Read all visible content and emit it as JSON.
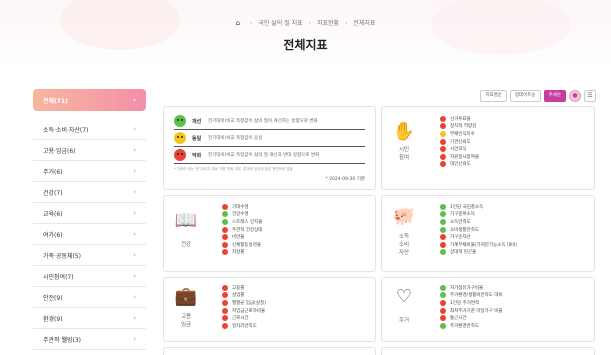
{
  "breadcrumb": {
    "home_icon": "home-icon",
    "items": [
      "국민 삶의 질 지표",
      "지표현황",
      "전체지표"
    ]
  },
  "page_title": "전체지표",
  "sidebar": {
    "items": [
      {
        "label": "전체(71)",
        "active": true
      },
      {
        "label": "소득·소비·자산(7)"
      },
      {
        "label": "고용·임금(6)"
      },
      {
        "label": "주거(6)"
      },
      {
        "label": "건강(7)"
      },
      {
        "label": "교육(6)"
      },
      {
        "label": "여가(6)"
      },
      {
        "label": "가족·공동체(5)"
      },
      {
        "label": "시민참여(7)"
      },
      {
        "label": "안전(9)"
      },
      {
        "label": "환경(9)"
      },
      {
        "label": "주관적 웰빙(3)"
      }
    ]
  },
  "toolbar": {
    "btn1": "지표명순",
    "btn2": "업데이트순",
    "btn3": "추세순",
    "icon1": "circle-icon",
    "icon2": "list-icon"
  },
  "legend": {
    "rows": [
      {
        "name": "개선",
        "desc": "전기대비(비교 측정값이 삶의 질이 개선하는 방향으로 변화",
        "color": "#5cc04b"
      },
      {
        "name": "동일",
        "desc": "전기대비(비교 측정값이 동일",
        "color": "#f3c51d"
      },
      {
        "name": "악화",
        "desc": "전기대비(비교 측정값이 삶의 질 개선과 반대 방향으로 변화",
        "color": "#ea4335"
      }
    ],
    "footnote": "* 기준이 되는 전기(비교) 대비 지표 변화 여부, 통계적 유의성 등은 판단하지 않음",
    "date": "* 2024-09-30 기준"
  },
  "categories": [
    {
      "id": "civic",
      "label": [
        "시민",
        "참여"
      ],
      "icon": "hand-vote-icon",
      "indicators": [
        {
          "label": "선거투표율",
          "status": "r"
        },
        {
          "label": "정치적 역량감",
          "status": "r"
        },
        {
          "label": "부패인식지수",
          "status": "y"
        },
        {
          "label": "기관신뢰도",
          "status": "r"
        },
        {
          "label": "시민의식",
          "status": "r"
        },
        {
          "label": "자원봉사참여율",
          "status": "r"
        },
        {
          "label": "대인신뢰도",
          "status": "r"
        }
      ]
    },
    {
      "id": "health",
      "label": [
        "건강"
      ],
      "icon": "book-icon",
      "indicators": [
        {
          "label": "기대수명",
          "status": "r"
        },
        {
          "label": "건강수명",
          "status": "g"
        },
        {
          "label": "스트레스 인지율",
          "status": "g"
        },
        {
          "label": "주관적 건강상태",
          "status": "r"
        },
        {
          "label": "비만율",
          "status": "r"
        },
        {
          "label": "신체활동실천율",
          "status": "r"
        },
        {
          "label": "자살률",
          "status": "r"
        }
      ]
    },
    {
      "id": "income",
      "label": [
        "소득",
        "소비",
        "자산"
      ],
      "icon": "piggy-bank-icon",
      "indicators": [
        {
          "label": "1인당 국민총소득",
          "status": "g"
        },
        {
          "label": "가구중위소득",
          "status": "g"
        },
        {
          "label": "소득만족도",
          "status": "g"
        },
        {
          "label": "소비생활만족도",
          "status": "g"
        },
        {
          "label": "가구순자산",
          "status": "r"
        },
        {
          "label": "가계부채비율(가처분가능소득 대비)",
          "status": "r"
        },
        {
          "label": "상대적 빈곤율",
          "status": "g"
        }
      ]
    },
    {
      "id": "employment",
      "label": [
        "고용",
        "임금"
      ],
      "icon": "briefcase-icon",
      "indicators": [
        {
          "label": "고용률",
          "status": "r"
        },
        {
          "label": "실업률",
          "status": "r"
        },
        {
          "label": "월평균 임금(실질)",
          "status": "r"
        },
        {
          "label": "저임금근로자비율",
          "status": "r"
        },
        {
          "label": "근로시간",
          "status": "r"
        },
        {
          "label": "일자리만족도",
          "status": "r"
        }
      ]
    },
    {
      "id": "housing",
      "label": [
        "주거"
      ],
      "icon": "heartbeat-icon",
      "indicators": [
        {
          "label": "자가점유가구비율",
          "status": "g"
        },
        {
          "label": "주거환경/생활비만족도 대비",
          "status": "g"
        },
        {
          "label": "1인당 주거면적",
          "status": "r"
        },
        {
          "label": "최저주거기준 미달가구 비율",
          "status": "r"
        },
        {
          "label": "통근시간",
          "status": "r"
        },
        {
          "label": "주거환경만족도",
          "status": "g"
        }
      ]
    }
  ]
}
